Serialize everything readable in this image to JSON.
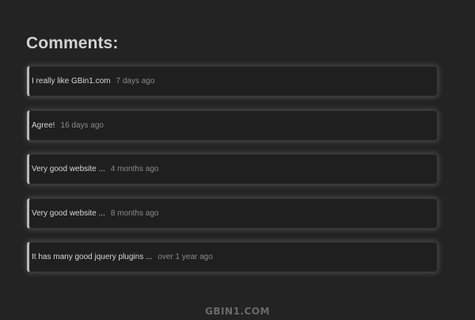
{
  "heading": "Comments:",
  "comments": [
    {
      "text": "I really like GBin1.com",
      "time": "7 days ago"
    },
    {
      "text": "Agree!",
      "time": "16 days ago"
    },
    {
      "text": "Very good website ...",
      "time": "4 months ago"
    },
    {
      "text": "Very good website ...",
      "time": "8 months ago"
    },
    {
      "text": "It has many good jquery plugins ...",
      "time": "over 1 year ago"
    }
  ],
  "watermark": "GBIN1.COM"
}
